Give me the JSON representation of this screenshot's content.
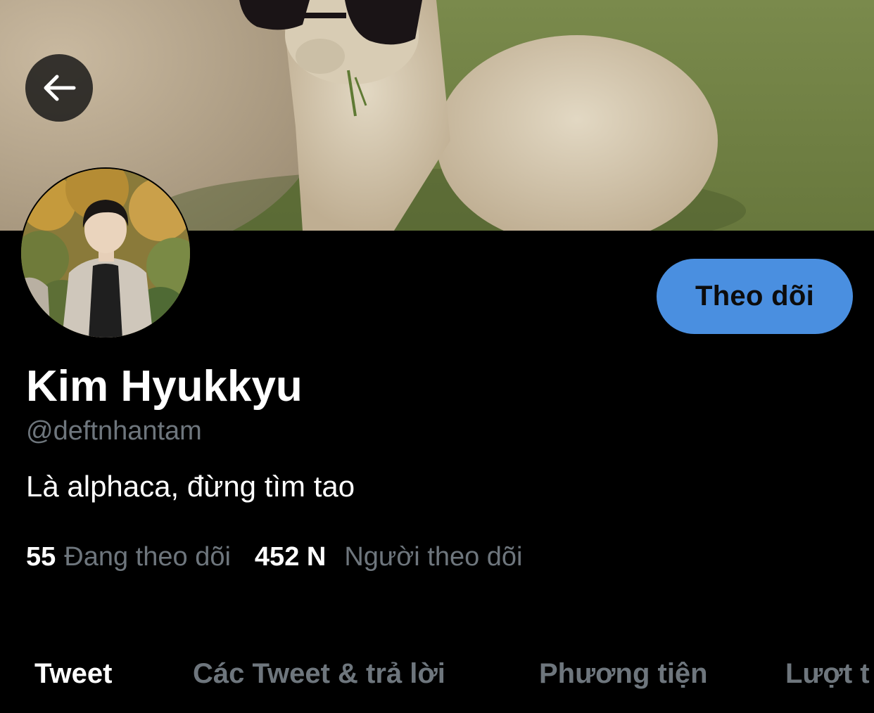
{
  "profile": {
    "display_name": "Kim Hyukkyu",
    "handle": "@deftnhantam",
    "bio": "Là alphaca, đừng tìm tao",
    "following_count": "55",
    "following_label": "Đang theo dõi",
    "followers_count": "452 N",
    "followers_label": "Người theo dõi"
  },
  "actions": {
    "follow_label": "Theo dõi"
  },
  "tabs": [
    {
      "label": "Tweet",
      "active": true
    },
    {
      "label": "Các Tweet & trả lời",
      "active": false
    },
    {
      "label": "Phương tiện",
      "active": false
    },
    {
      "label": "Lượt t",
      "active": false
    }
  ],
  "colors": {
    "background": "#000000",
    "accent": "#4a8fe0",
    "secondary_text": "#6e767d",
    "primary_text": "#ffffff"
  },
  "icons": {
    "back": "arrow-left-icon"
  }
}
